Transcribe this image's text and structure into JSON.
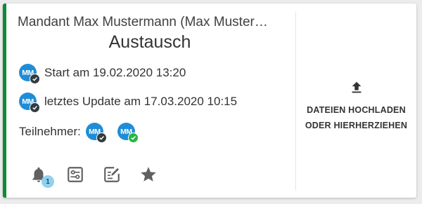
{
  "card": {
    "mandant": "Mandant Max Mustermann (Max Muster…",
    "title": "Austausch",
    "start_text": "Start am 19.02.2020 13:20",
    "update_text": "letztes Update am 17.03.2020 10:15",
    "participants_label": "Teilnehmer:",
    "participants": [
      {
        "initials": "MM",
        "status": "check-dark"
      },
      {
        "initials": "MM",
        "status": "check-green"
      }
    ],
    "start_avatar": {
      "initials": "MM",
      "status": "check-dark"
    },
    "update_avatar": {
      "initials": "MM",
      "status": "check-dark"
    },
    "notification_count": "1",
    "upload_line1": "DATEIEN HOCHLADEN",
    "upload_line2": "ODER HIERHERZIEHEN"
  },
  "colors": {
    "accent_border": "#0e8a35",
    "avatar": "#1f8dd6",
    "badge_dark": "#333a40",
    "badge_green": "#25b741",
    "notification_badge": "#8fd2f0"
  },
  "icons": {
    "notifications": "bell-icon",
    "settings": "sliders-icon",
    "edit": "edit-note-icon",
    "favorite": "star-icon",
    "upload": "upload-icon"
  }
}
